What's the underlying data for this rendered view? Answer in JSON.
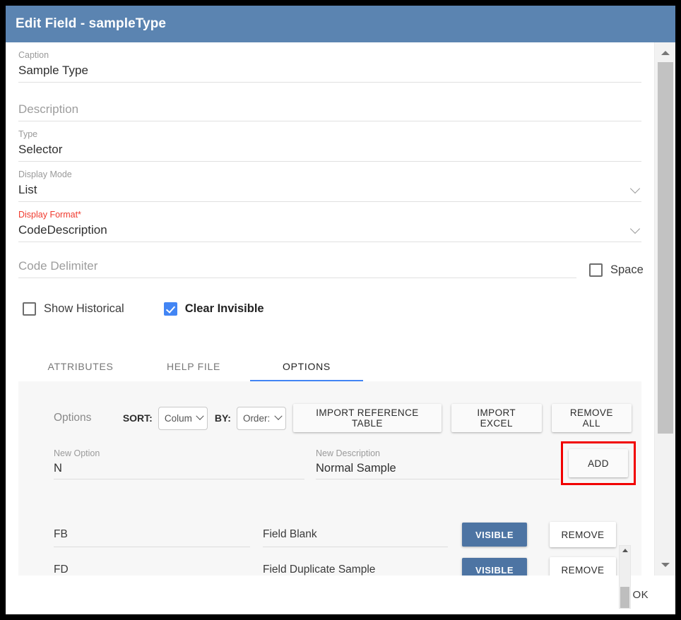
{
  "dialog": {
    "title": "Edit Field - sampleType"
  },
  "form": {
    "caption": {
      "label": "Caption",
      "value": "Sample Type"
    },
    "description": {
      "placeholder": "Description"
    },
    "type": {
      "label": "Type",
      "value": "Selector"
    },
    "display_mode": {
      "label": "Display Mode",
      "value": "List"
    },
    "display_format": {
      "label": "Display Format",
      "required_mark": "*",
      "value": "CodeDescription"
    },
    "code_delimiter": {
      "placeholder": "Code Delimiter"
    },
    "space_checkbox": {
      "label": "Space",
      "checked": false
    },
    "show_historical": {
      "label": "Show Historical",
      "checked": false
    },
    "clear_invisible": {
      "label": "Clear Invisible",
      "checked": true
    }
  },
  "tabs": [
    {
      "label": "ATTRIBUTES",
      "active": false
    },
    {
      "label": "HELP FILE",
      "active": false
    },
    {
      "label": "OPTIONS",
      "active": true
    }
  ],
  "options_panel": {
    "title": "Options",
    "sort_label": "SORT:",
    "sort_value": "Colum",
    "by_label": "BY:",
    "by_value": "Order:",
    "buttons": {
      "import_reference_table": "IMPORT REFERENCE TABLE",
      "import_excel": "IMPORT EXCEL",
      "remove_all": "REMOVE ALL",
      "add": "ADD"
    },
    "new_option": {
      "label": "New Option",
      "value": "N"
    },
    "new_description": {
      "label": "New Description",
      "value": "Normal Sample"
    },
    "rows": [
      {
        "code": "FB",
        "description": "Field Blank",
        "visible_label": "VISIBLE",
        "remove_label": "REMOVE"
      },
      {
        "code": "FD",
        "description": "Field Duplicate Sample",
        "visible_label": "VISIBLE",
        "remove_label": "REMOVE"
      }
    ]
  },
  "footer": {
    "ok_label": "OK"
  },
  "colors": {
    "titlebar": "#5b84b1",
    "accent_blue": "#4285f4",
    "visible_button": "#4d74a3",
    "required_red": "#f03a2e",
    "highlight_red": "#f10000",
    "panel_bg": "#f7f7f7"
  }
}
